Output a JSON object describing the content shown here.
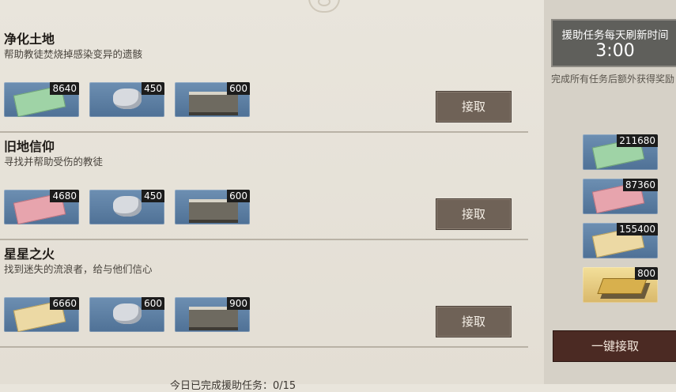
{
  "quests": [
    {
      "title": "净化土地",
      "desc": "帮助教徒焚烧掉感染变异的遗骸",
      "rewards": [
        {
          "icon": "green-banknote",
          "count": "8640"
        },
        {
          "icon": "silver-gem",
          "count": "450"
        },
        {
          "icon": "cash-stack",
          "count": "600"
        }
      ],
      "button": "接取"
    },
    {
      "title": "旧地信仰",
      "desc": "寻找并帮助受伤的教徒",
      "rewards": [
        {
          "icon": "red-banknote",
          "count": "4680"
        },
        {
          "icon": "silver-gem",
          "count": "450"
        },
        {
          "icon": "cash-stack",
          "count": "600"
        }
      ],
      "button": "接取"
    },
    {
      "title": "星星之火",
      "desc": "找到迷失的流浪者，给与他们信心",
      "rewards": [
        {
          "icon": "yellow-banknote",
          "count": "6660"
        },
        {
          "icon": "silver-gem",
          "count": "600"
        },
        {
          "icon": "cash-stack",
          "count": "900"
        }
      ],
      "button": "接取"
    }
  ],
  "footer": {
    "completed_text": "今日已完成援助任务：0/15"
  },
  "side": {
    "refresh_label": "援助任务每天刷新时间",
    "refresh_time": "3:00",
    "bonus_note": "完成所有任务后额外获得奖励",
    "bonus_rewards": [
      {
        "icon": "green-banknote",
        "count": "211680"
      },
      {
        "icon": "red-banknote",
        "count": "87360"
      },
      {
        "icon": "yellow-banknote",
        "count": "155400"
      },
      {
        "icon": "gold-bars",
        "count": "800"
      }
    ],
    "claim_all": "一键接取"
  }
}
